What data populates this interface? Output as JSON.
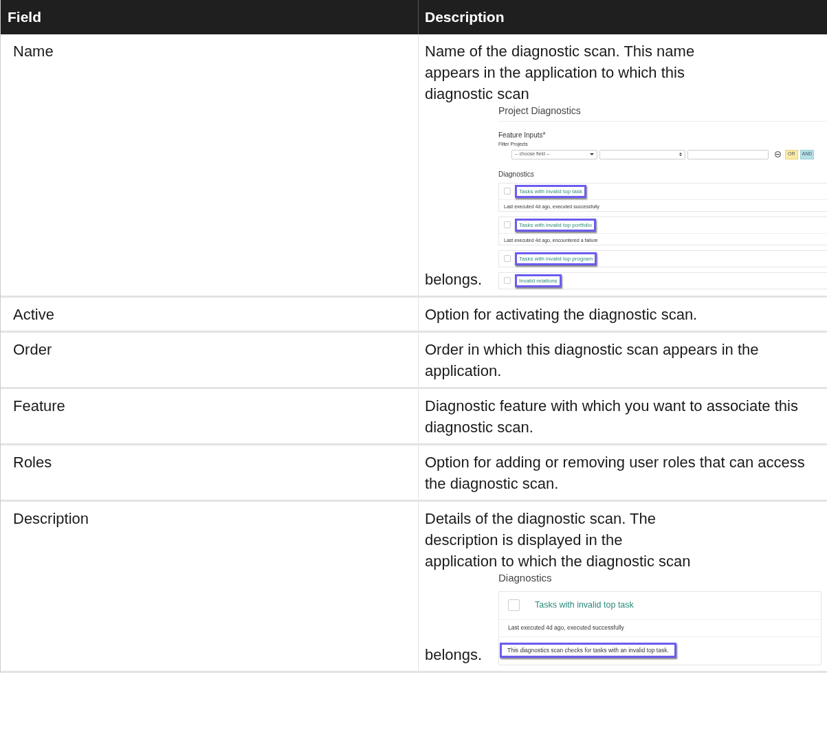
{
  "table": {
    "columns": [
      "Field",
      "Description"
    ],
    "rows": [
      {
        "field": "Name",
        "kind": "with_screenshot",
        "description": "Name of the diagnostic scan. This name appears in the application to which this diagnostic scan",
        "description_end": "belongs.",
        "screenshot": {
          "kind": "project_diagnostics",
          "title": "Project Diagnostics",
          "feature_inputs_label": "Feature Inputs*",
          "filter_label": "Filter Projects",
          "field_select": "-- choose field --",
          "or_button": "OR",
          "and_button": "AND",
          "section_title": "Diagnostics",
          "items": [
            {
              "title": "Tasks with invalid top task",
              "checked": false,
              "highlighted": true,
              "status": "Last executed 4d ago, executed successfully"
            },
            {
              "title": "Tasks with invalid top portfolio",
              "checked": false,
              "highlighted": true,
              "status": "Last executed 4d ago, encountered a failure"
            },
            {
              "title": "Tasks with invalid top program",
              "checked": false,
              "highlighted": true
            },
            {
              "title": "Invalid relations",
              "checked": false,
              "highlighted": true
            }
          ]
        }
      },
      {
        "field": "Active",
        "kind": "text",
        "description": "Option for activating the diagnostic scan."
      },
      {
        "field": "Order",
        "kind": "text",
        "description": "Order in which this diagnostic scan appears in the application."
      },
      {
        "field": "Feature",
        "kind": "text",
        "description": "Diagnostic feature with which you want to associate this diagnostic scan."
      },
      {
        "field": "Roles",
        "kind": "text",
        "description": "Option for adding or removing user roles that can access the diagnostic scan."
      },
      {
        "field": "Description",
        "kind": "with_screenshot",
        "description": "Details of the diagnostic scan. The description is displayed in the application to which the diagnostic scan",
        "description_end": "belongs.",
        "screenshot": {
          "kind": "diagnostic_detail",
          "section_title": "Diagnostics",
          "item": {
            "title": "Tasks with invalid top task",
            "checked": false,
            "status": "Last executed 4d ago, executed successfully",
            "description": "This diagnostics scan checks for tasks with an invalid top task.",
            "highlighted": true
          }
        }
      }
    ]
  }
}
